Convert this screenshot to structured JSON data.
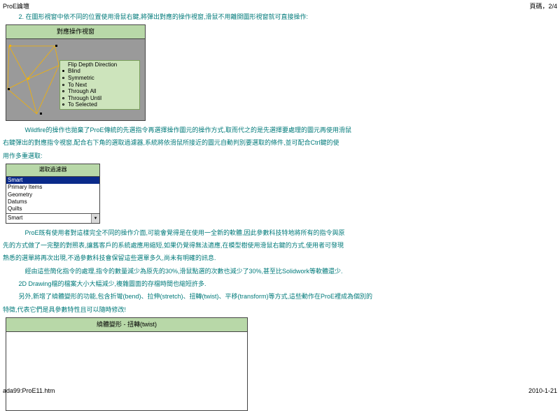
{
  "header": {
    "title": "ProE論壇",
    "page": "頁碼，2/4"
  },
  "paras": {
    "p1": "2.  在圖形視窗中依不同的位置使用滑鼠右鍵,將彈出對應的操作視窗,滑鼠不用離開圖形視窗就可直接操作:",
    "p2": "Wildfire的操作也拋棄了ProE傳統的先選指令再選擇操作圖元的操作方式,取而代之的是先選擇要處理的圖元再使用滑鼠",
    "p3": "右鍵彈出的對應指令視窗,配合右下角的選取過濾器,系統將依滑鼠所接近的圖元自動判別要選取的條件,並可配合Ctrl鍵的使",
    "p4": "用作多重選取:",
    "p5": "ProE既有使用者對這樣完全不同的操作介面,可能會覺得是在使用一全新的軟體,因此參數科技特地將所有的指令與原",
    "p6": "先的方式做了一完整的對照表,讓舊客戶的系統處應用縮短,如果仍覺得無法適應,在模型樹使用滑鼠右鍵的方式,使用者可發現",
    "p7": "熟悉的選單將再次出現,不過參數科技會保留這些選單多久,尚未有明確的訊息.",
    "p8": "經由這些簡化指令的處理,指令的數量減少為原先的30%,滑鼠點選的次數也減少了30%,甚至比Solidwork等軟體還少.",
    "p9": "2D Drawing檔的檔案大小大幅減少,複雜圖面的存檔時間也縮短許多.",
    "p10": "另外,新增了繞體變形的功能,包含折彎(bend)、拉伸(stretch)、扭轉(twist)、平移(transform)等方式,這些動作在ProE裡成為個別的",
    "p11": "特徵,代表它們是具參數特性且可以隨時修改!"
  },
  "figure1": {
    "title": "對應操作視窗",
    "menu": {
      "header": "Flip Depth Direction",
      "items": [
        "Blind",
        "Symmetric",
        "To Next",
        "Through All",
        "Through Until",
        "To Selected"
      ]
    }
  },
  "filter": {
    "title": "選取過濾器",
    "items": [
      "Smart",
      "Primary Items",
      "Geometry",
      "Datums",
      "Quilts"
    ],
    "combo": "Smart",
    "arrow": "▾"
  },
  "figure2": {
    "title": "繞體變形 - 扭轉(twist)"
  },
  "footer": {
    "path": "ada99:ProE11.htm",
    "date": "2010-1-21"
  }
}
